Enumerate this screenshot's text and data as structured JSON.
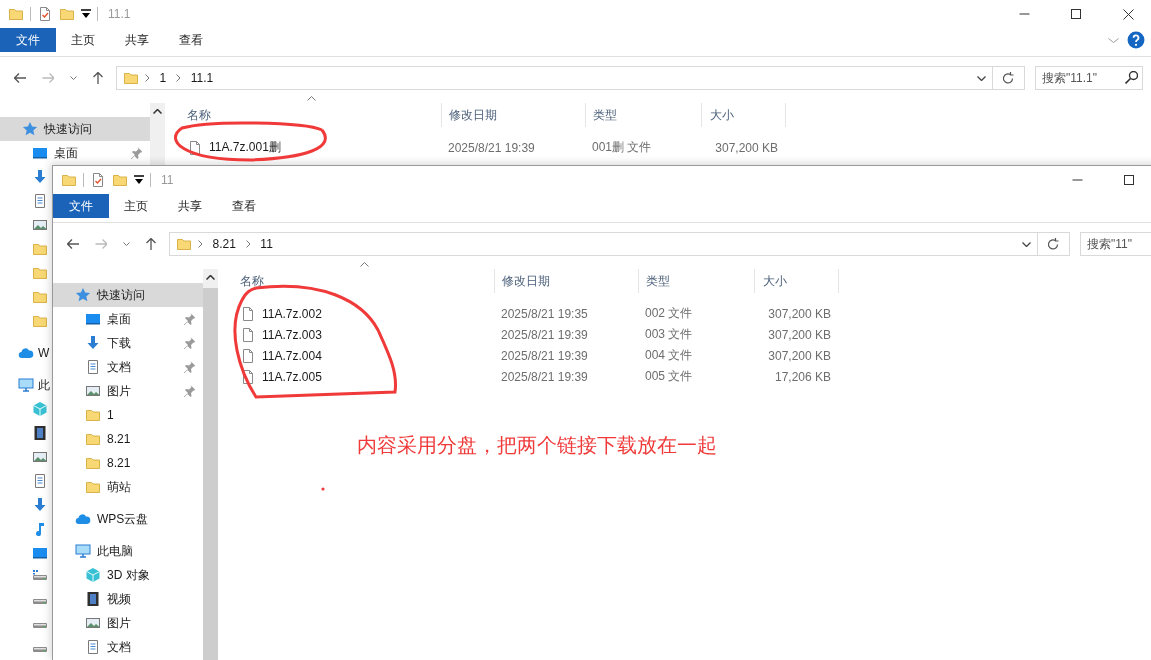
{
  "windows": [
    {
      "title": "11.1",
      "ribbon_tabs": [
        {
          "kind": "file_menu",
          "label": "文件"
        },
        {
          "kind": "tab",
          "label": "主页"
        },
        {
          "kind": "tab",
          "label": "共享"
        },
        {
          "kind": "tab",
          "label": "查看"
        }
      ],
      "path": [
        "1",
        "11.1"
      ],
      "search_placeholder": "搜索\"11.1\"",
      "columns": [
        "名称",
        "修改日期",
        "类型",
        "大小"
      ],
      "files": [
        {
          "name": "11A.7z.001删",
          "modified": "2025/8/21 19:39",
          "type": "001删 文件",
          "size": "307,200 KB"
        }
      ],
      "sidebar": [
        {
          "kind": "star",
          "label": "快速访问",
          "selected": true,
          "children": [
            {
              "kind": "desktop",
              "label": "桌面",
              "pinned": true,
              "selected": false
            },
            {
              "kind": "download",
              "pinned": false,
              "selected": false
            },
            {
              "kind": "doc",
              "pinned": false,
              "selected": false
            },
            {
              "kind": "picture",
              "pinned": false,
              "selected": false
            },
            {
              "kind": "folder",
              "pinned": false,
              "selected": false
            },
            {
              "kind": "folder",
              "pinned": false,
              "selected": false
            },
            {
              "kind": "folder",
              "pinned": false,
              "selected": false
            },
            {
              "kind": "folder",
              "pinned": false,
              "selected": false
            }
          ]
        },
        {
          "kind": "cloud",
          "label": "W",
          "selected": false
        },
        {
          "kind": "pc",
          "label": "此",
          "selected": false,
          "children": [
            {
              "kind": "cube",
              "selected": false
            },
            {
              "kind": "film",
              "selected": false
            },
            {
              "kind": "picture",
              "selected": false
            },
            {
              "kind": "doc",
              "selected": false
            },
            {
              "kind": "download",
              "selected": false
            },
            {
              "kind": "music",
              "selected": false
            },
            {
              "kind": "desktop",
              "selected": false
            },
            {
              "kind": "netdrive",
              "selected": false
            },
            {
              "kind": "drive",
              "selected": false
            },
            {
              "kind": "drive",
              "selected": false
            },
            {
              "kind": "drive",
              "selected": false
            }
          ]
        }
      ]
    },
    {
      "title": "11",
      "ribbon_tabs": [
        {
          "kind": "file_menu",
          "label": "文件"
        },
        {
          "kind": "tab",
          "label": "主页"
        },
        {
          "kind": "tab",
          "label": "共享"
        },
        {
          "kind": "tab",
          "label": "查看"
        }
      ],
      "path": [
        "8.21",
        "11"
      ],
      "search_placeholder": "搜索\"11\"",
      "columns": [
        "名称",
        "修改日期",
        "类型",
        "大小"
      ],
      "files": [
        {
          "name": "11A.7z.002",
          "modified": "2025/8/21 19:35",
          "type": "002 文件",
          "size": "307,200 KB"
        },
        {
          "name": "11A.7z.003",
          "modified": "2025/8/21 19:39",
          "type": "003 文件",
          "size": "307,200 KB"
        },
        {
          "name": "11A.7z.004",
          "modified": "2025/8/21 19:39",
          "type": "004 文件",
          "size": "307,200 KB"
        },
        {
          "name": "11A.7z.005",
          "modified": "2025/8/21 19:39",
          "type": "005 文件",
          "size": "17,206 KB"
        }
      ],
      "sidebar": [
        {
          "kind": "star",
          "label": "快速访问",
          "selected": true,
          "children": [
            {
              "kind": "desktop",
              "label": "桌面",
              "pinned": true,
              "selected": false
            },
            {
              "kind": "download",
              "label": "下载",
              "pinned": true,
              "selected": false
            },
            {
              "kind": "doc",
              "label": "文档",
              "pinned": true,
              "selected": false
            },
            {
              "kind": "picture",
              "label": "图片",
              "pinned": true,
              "selected": false
            },
            {
              "kind": "folder",
              "label": "1",
              "pinned": false,
              "selected": false
            },
            {
              "kind": "folder",
              "label": "8.21",
              "pinned": false,
              "selected": false
            },
            {
              "kind": "folder",
              "label": "8.21",
              "pinned": false,
              "selected": false
            },
            {
              "kind": "folder",
              "label": "萌站",
              "pinned": false,
              "selected": false
            }
          ]
        },
        {
          "kind": "cloud",
          "label": "WPS云盘",
          "selected": false
        },
        {
          "kind": "pc",
          "label": "此电脑",
          "selected": false,
          "children": [
            {
              "kind": "cube",
              "label": "3D 对象",
              "selected": false
            },
            {
              "kind": "film",
              "label": "视频",
              "selected": false
            },
            {
              "kind": "picture",
              "label": "图片",
              "selected": false
            },
            {
              "kind": "doc",
              "label": "文档",
              "selected": false
            }
          ]
        }
      ]
    }
  ],
  "annotation": {
    "note": "内容采用分盘，把两个链接下载放在一起"
  }
}
